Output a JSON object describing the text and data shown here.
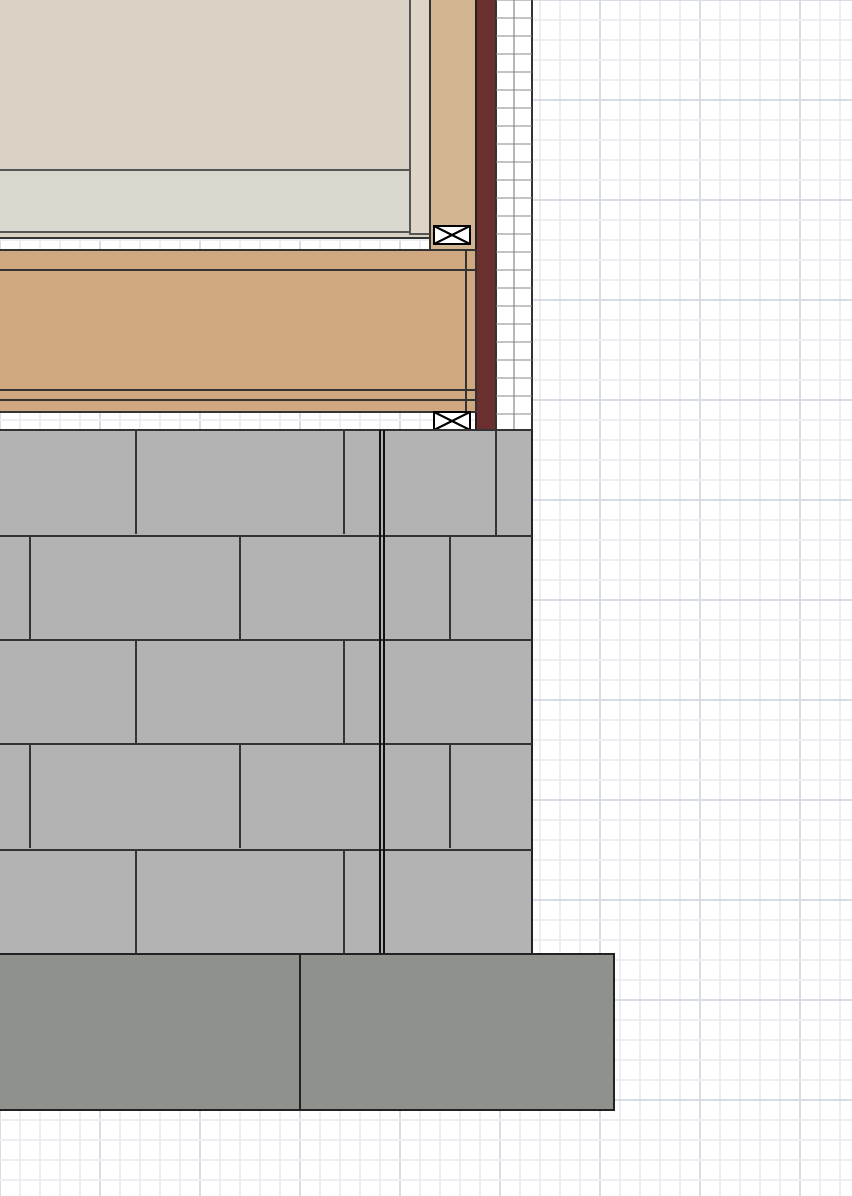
{
  "drawing": {
    "kind": "wall-section"
  }
}
